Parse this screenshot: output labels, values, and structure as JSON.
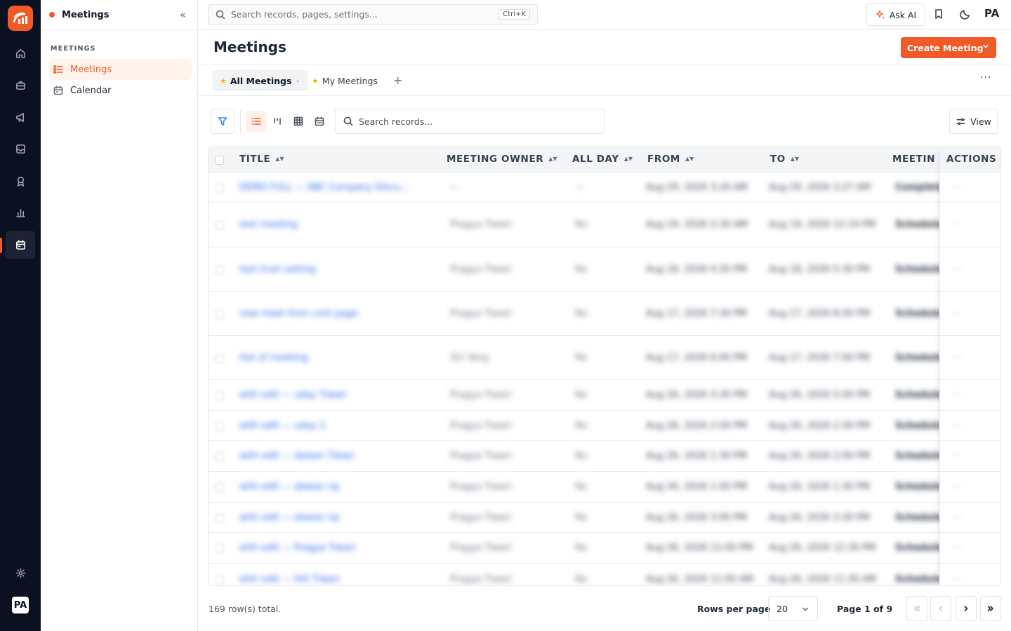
{
  "app": {
    "logo_icon": "app-logo-icon",
    "accent_color": "#f05a28",
    "rail_background": "#0b1120",
    "user_initials": "PA"
  },
  "rail": {
    "items": [
      {
        "icon": "home-icon"
      },
      {
        "icon": "briefcase-icon"
      },
      {
        "icon": "megaphone-icon"
      },
      {
        "icon": "inbox-icon"
      },
      {
        "icon": "award-icon"
      },
      {
        "icon": "bar-chart-icon"
      },
      {
        "icon": "calendar-icon",
        "active": true
      }
    ],
    "bottom": {
      "settings_icon": "gear-icon",
      "avatar": "PA"
    }
  },
  "sidebar": {
    "title": "Meetings",
    "section_label": "MEETINGS",
    "items": [
      {
        "label": "Meetings",
        "icon": "list-icon",
        "active": true
      },
      {
        "label": "Calendar",
        "icon": "calendar-icon",
        "active": false
      }
    ]
  },
  "topbar": {
    "search_placeholder": "Search records, pages, settings...",
    "shortcut": "Ctrl+K",
    "ask_ai": "Ask AI",
    "user_initials": "PA"
  },
  "page": {
    "title": "Meetings",
    "create_button": "Create Meeting"
  },
  "tabs": [
    {
      "label": "All Meetings",
      "active": true
    },
    {
      "label": "My Meetings",
      "active": false
    }
  ],
  "toolbar": {
    "search_placeholder": "Search records...",
    "view_label": "View"
  },
  "table": {
    "columns": [
      "TITLE",
      "MEETING OWNER",
      "ALL DAY",
      "FROM",
      "TO",
      "MEETIN",
      "ACTIONS"
    ],
    "rows": [
      {
        "title": "DEMO FULL — ABC Company Discu...",
        "owner": "—",
        "all_day": "—",
        "from": "Aug 29, 2026 3:26 AM",
        "to": "Aug 29, 2026 3:27 AM",
        "status": "Complete"
      },
      {
        "title": "test meeting",
        "owner": "Pragya Tiwari",
        "all_day": "No",
        "from": "Aug 19, 2026 3:30 AM",
        "to": "Aug 19, 2026 12:19 PM",
        "status": "Scheduled"
      },
      {
        "title": "test trust setting",
        "owner": "Pragya Tiwari",
        "all_day": "No",
        "from": "Aug 18, 2026 4:30 PM",
        "to": "Aug 18, 2026 5:30 PM",
        "status": "Scheduled"
      },
      {
        "title": "new meet from cont page",
        "owner": "Pragya Tiwari",
        "all_day": "No",
        "from": "Aug 17, 2026 7:30 PM",
        "to": "Aug 17, 2026 8:30 PM",
        "status": "Scheduled"
      },
      {
        "title": "link of meeting",
        "owner": "Shi Yang",
        "all_day": "No",
        "from": "Aug 17, 2026 6:00 PM",
        "to": "Aug 17, 2026 7:00 PM",
        "status": "Scheduled"
      },
      {
        "title": "with edit — uday Tiwari",
        "owner": "Pragya Tiwari",
        "all_day": "No",
        "from": "Aug 26, 2026 3:30 PM",
        "to": "Aug 26, 2026 5:00 PM",
        "status": "Scheduled"
      },
      {
        "title": "with edit — uday 2",
        "owner": "Pragya Tiwari",
        "all_day": "No",
        "from": "Aug 26, 2026 2:00 PM",
        "to": "Aug 26, 2026 2:30 PM",
        "status": "Scheduled"
      },
      {
        "title": "with edit — dewan Tiwari",
        "owner": "Pragya Tiwari",
        "all_day": "No",
        "from": "Aug 26, 2026 1:30 PM",
        "to": "Aug 26, 2026 2:00 PM",
        "status": "Scheduled"
      },
      {
        "title": "with edit — dewan raj",
        "owner": "Pragya Tiwari",
        "all_day": "No",
        "from": "Aug 26, 2026 1:00 PM",
        "to": "Aug 26, 2026 1:30 PM",
        "status": "Scheduled"
      },
      {
        "title": "with edit — dewan raj",
        "owner": "Pragya Tiwari",
        "all_day": "No",
        "from": "Aug 26, 2026 3:00 PM",
        "to": "Aug 26, 2026 3:30 PM",
        "status": "Scheduled"
      },
      {
        "title": "with edit — Pragya Tiwari",
        "owner": "Pragya Tiwari",
        "all_day": "No",
        "from": "Aug 26, 2026 12:00 PM",
        "to": "Aug 26, 2026 12:30 PM",
        "status": "Scheduled"
      },
      {
        "title": "with edit — Hiti Tiwari",
        "owner": "Pragya Tiwari",
        "all_day": "No",
        "from": "Aug 26, 2026 11:00 AM",
        "to": "Aug 26, 2026 11:30 AM",
        "status": "Scheduled"
      }
    ]
  },
  "footer": {
    "total": "169 row(s) total.",
    "rows_per_page_label": "Rows per page",
    "rows_per_page_value": "20",
    "page_label": "Page 1 of 9"
  }
}
